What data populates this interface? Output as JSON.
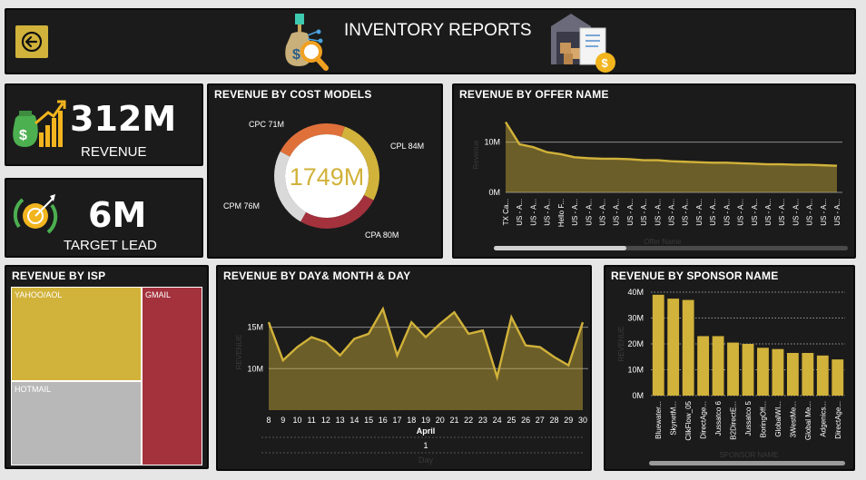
{
  "header": {
    "title": "INVENTORY REPORTS",
    "back_icon": "back-arrow-icon",
    "left_icon": "money-search-icon",
    "right_icon": "warehouse-invoice-icon"
  },
  "kpis": {
    "revenue": {
      "value": "312M",
      "label": "REVENUE",
      "icon": "money-bag-growth-icon"
    },
    "target_lead": {
      "value": "6M",
      "label": "TARGET LEAD",
      "icon": "target-cycle-icon"
    }
  },
  "colors": {
    "gold": "#d1b23a",
    "panel": "#1b1b1b",
    "red": "#a3323d",
    "orange": "#e0703a",
    "grey": "#bdbdbd"
  },
  "chart_data": [
    {
      "id": "cost_models",
      "type": "pie",
      "title": "REVENUE BY COST MODELS",
      "center_label": "1749M",
      "slices": [
        {
          "label": "CPL 84M",
          "value": 84,
          "color": "#d1b23a"
        },
        {
          "label": "CPA 80M",
          "value": 80,
          "color": "#a3323d"
        },
        {
          "label": "CPM 76M",
          "value": 76,
          "color": "#d9d9d9"
        },
        {
          "label": "CPC 71M",
          "value": 71,
          "color": "#e0703a"
        }
      ]
    },
    {
      "id": "offer_name",
      "type": "area",
      "title": "REVENUE BY OFFER NAME",
      "ylabel": "Revenue",
      "xlabel": "Offer Name",
      "yticks": [
        "0M",
        "10M"
      ],
      "ylim": [
        0,
        15
      ],
      "categories": [
        "TX Ca...",
        "US - A...",
        "US - A...",
        "US - A...",
        "Hello F...",
        "US - A...",
        "US - A...",
        "US - A...",
        "US - A...",
        "US - A...",
        "US - A...",
        "US - A...",
        "US - A...",
        "US - A...",
        "US - A...",
        "US - A...",
        "US - A...",
        "US - A...",
        "US - A...",
        "US - A...",
        "US - A...",
        "US - A...",
        "US - A...",
        "US - A...",
        "US - A..."
      ],
      "values": [
        14,
        9.6,
        9.0,
        8.0,
        7.6,
        7.0,
        6.8,
        6.7,
        6.7,
        6.6,
        6.4,
        6.4,
        6.2,
        6.1,
        6.0,
        5.9,
        5.9,
        5.8,
        5.7,
        5.6,
        5.6,
        5.5,
        5.5,
        5.4,
        5.3
      ]
    },
    {
      "id": "isp",
      "type": "treemap",
      "title": "REVENUE BY ISP",
      "items": [
        {
          "label": "YAHOO/AOL",
          "color": "#d1b23a"
        },
        {
          "label": "HOTMAIL",
          "color": "#b8b8b8"
        },
        {
          "label": "GMAIL",
          "color": "#a3323d"
        }
      ]
    },
    {
      "id": "day",
      "type": "area",
      "title": "REVENUE BY DAY& MONTH & DAY",
      "ylabel": "REVENUE",
      "xlabel": "Day",
      "yticks": [
        "10M",
        "15M"
      ],
      "ylim": [
        5,
        19
      ],
      "month_label": "April",
      "group_label": "1",
      "categories": [
        "8",
        "9",
        "10",
        "11",
        "12",
        "13",
        "14",
        "15",
        "16",
        "17",
        "18",
        "19",
        "20",
        "21",
        "22",
        "23",
        "24",
        "25",
        "26",
        "27",
        "28",
        "29",
        "30"
      ],
      "values": [
        15.6,
        11.0,
        12.6,
        13.8,
        13.2,
        11.6,
        13.6,
        14.2,
        17.2,
        11.6,
        15.6,
        13.8,
        15.4,
        16.8,
        14.2,
        14.6,
        9.0,
        16.2,
        12.8,
        12.6,
        11.4,
        10.4,
        15.6
      ]
    },
    {
      "id": "sponsor",
      "type": "bar",
      "title": "REVENUE BY SPONSOR NAME",
      "ylabel": "REVENUE",
      "xlabel": "SPONSOR NAME",
      "yticks": [
        "0M",
        "10M",
        "20M",
        "30M",
        "40M"
      ],
      "ylim": [
        0,
        40
      ],
      "categories": [
        "Bluewater...",
        "SkynetM...",
        "ClikFlow_05",
        "DirectAge...",
        "Jussatco 6",
        "B2DirectE...",
        "Jussatco 5",
        "BoringOff...",
        "GlobalWI...",
        "3WestMe...",
        "Global Me...",
        "Adgenics...",
        "DirectAge..."
      ],
      "values": [
        39,
        37.5,
        37,
        23,
        23,
        20.5,
        20,
        18.5,
        18,
        16.5,
        16.5,
        15.5,
        14
      ]
    }
  ]
}
